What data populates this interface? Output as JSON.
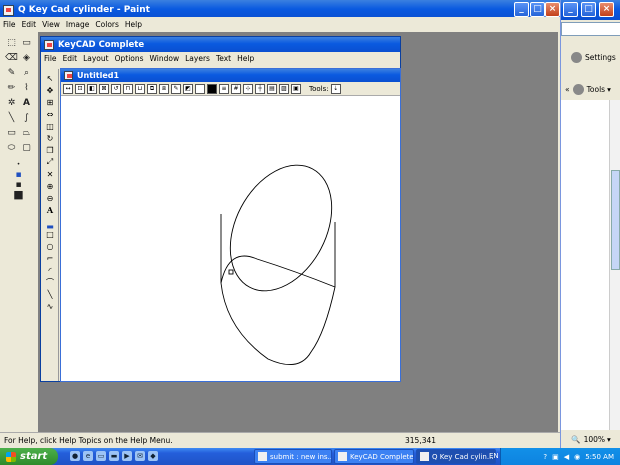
{
  "paint": {
    "title": "Q Key Cad cylinder - Paint",
    "menu": [
      "File",
      "Edit",
      "View",
      "Image",
      "Colors",
      "Help"
    ],
    "status_help": "For Help, click Help Topics on the Help Menu.",
    "status_coords": "315,341"
  },
  "keycad": {
    "title": "KeyCAD Complete",
    "menu": [
      "File",
      "Edit",
      "Layout",
      "Options",
      "Window",
      "Layers",
      "Text",
      "Help"
    ],
    "document": {
      "title": "Untitled1",
      "tools_label": "Tools:"
    }
  },
  "browser": {
    "settings_label": "Settings",
    "tools_label": "Tools",
    "zoom": "100%"
  },
  "taskbar": {
    "start_label": "start",
    "tasks": [
      {
        "label": "submit : new ins..."
      },
      {
        "label": "KeyCAD Complete"
      },
      {
        "label": "Q Key Cad cylin..."
      }
    ],
    "language": "EN",
    "clock": "5:50 AM"
  },
  "colors": {
    "title_bar": "#0a5ae0",
    "window_face": "#ece9d8",
    "canvas": "#ffffff",
    "paint_workspace": "#808080",
    "taskbar": "#245edb",
    "start_button": "#2e8a2b"
  }
}
